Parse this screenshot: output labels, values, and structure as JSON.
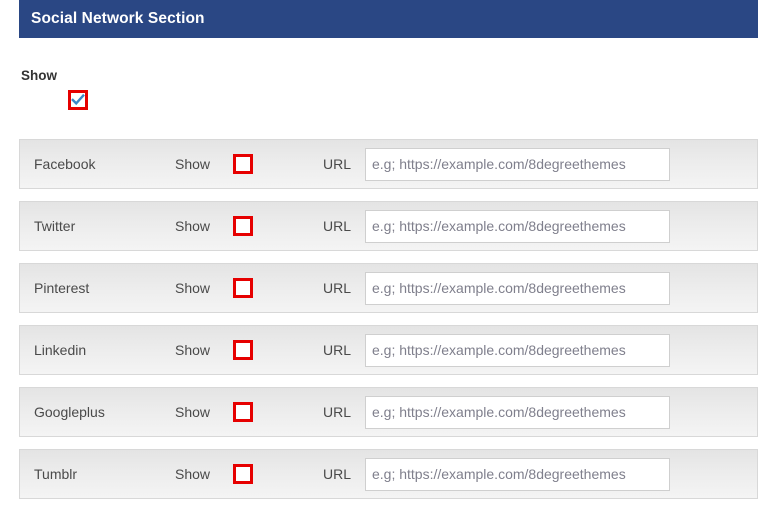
{
  "header": {
    "title": "Social Network Section",
    "background_color": "#2a4784",
    "text_color": "#ffffff"
  },
  "global_toggle": {
    "label": "Show",
    "checked": true,
    "checkbox_border_color": "#e60000",
    "check_color": "#3a87c8"
  },
  "columns": {
    "show_label": "Show",
    "url_label": "URL"
  },
  "url_placeholder": "e.g; https://example.com/8degreethemes",
  "networks": [
    {
      "name": "Facebook",
      "show_label": "Show",
      "url_label": "URL",
      "checked": false,
      "url_value": ""
    },
    {
      "name": "Twitter",
      "show_label": "Show",
      "url_label": "URL",
      "checked": false,
      "url_value": ""
    },
    {
      "name": "Pinterest",
      "show_label": "Show",
      "url_label": "URL",
      "checked": false,
      "url_value": ""
    },
    {
      "name": "Linkedin",
      "show_label": "Show",
      "url_label": "URL",
      "checked": false,
      "url_value": ""
    },
    {
      "name": "Googleplus",
      "show_label": "Show",
      "url_label": "URL",
      "checked": false,
      "url_value": ""
    },
    {
      "name": "Tumblr",
      "show_label": "Show",
      "url_label": "URL",
      "checked": false,
      "url_value": ""
    }
  ]
}
